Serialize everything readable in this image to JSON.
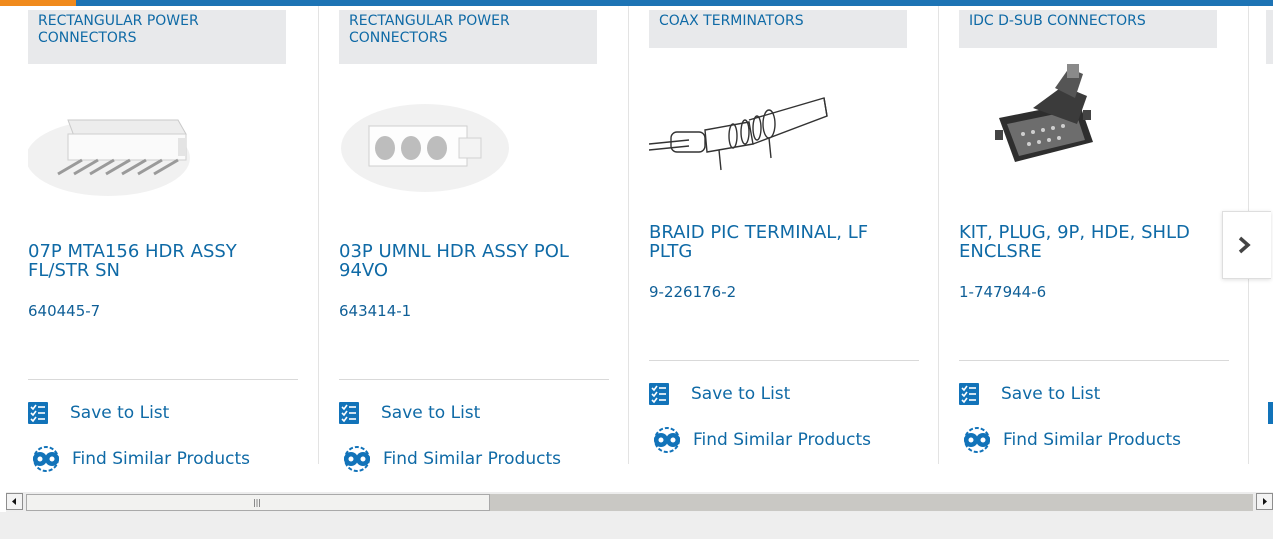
{
  "products": [
    {
      "category": "RECTANGULAR POWER CONNECTORS",
      "title": "07P MTA156 HDR ASSY FL/STR SN",
      "part_number": "640445-7",
      "save_label": "Save to List",
      "find_label": "Find Similar Products",
      "image_icon": "connector-header-7pin-image"
    },
    {
      "category": "RECTANGULAR POWER CONNECTORS",
      "title": "03P UMNL HDR ASSY POL 94VO",
      "part_number": "643414-1",
      "save_label": "Save to List",
      "find_label": "Find Similar Products",
      "image_icon": "connector-housing-3pos-image"
    },
    {
      "category": "COAX TERMINATORS",
      "title": "BRAID PIC TERMINAL, LF PLTG",
      "part_number": "9-226176-2",
      "save_label": "Save to List",
      "find_label": "Find Similar Products",
      "image_icon": "braid-terminal-image"
    },
    {
      "category": "IDC D-SUB CONNECTORS",
      "title": "KIT, PLUG, 9P, HDE, SHLD ENCLSRE",
      "part_number": "1-747944-6",
      "save_label": "Save to List",
      "find_label": "Find Similar Products",
      "image_icon": "dsub-plug-kit-image"
    }
  ],
  "carousel": {
    "next_icon": "chevron-right-icon"
  },
  "colors": {
    "accent_orange": "#f08a1d",
    "brand_blue": "#1d73b4",
    "link_blue": "#0f6aa6",
    "category_bg": "#e8e9eb"
  }
}
